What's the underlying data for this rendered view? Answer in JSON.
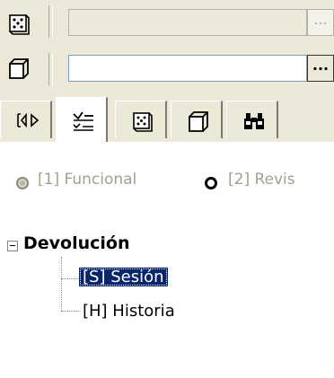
{
  "toolbar": {
    "row1": {
      "icon": "dice-icon",
      "field_value": "",
      "button_label": "..."
    },
    "row2": {
      "icon": "cube-icon",
      "field_value": "",
      "button_label": "..."
    }
  },
  "tabs": [
    {
      "name": "tab-navigate",
      "icon": "navigate-arrows-icon",
      "active": false
    },
    {
      "name": "tab-checklist",
      "icon": "checklist-icon",
      "active": true
    },
    {
      "name": "tab-dice",
      "icon": "dice-icon",
      "active": false
    },
    {
      "name": "tab-cube",
      "icon": "cube-icon",
      "active": false
    },
    {
      "name": "tab-binoculars",
      "icon": "binoculars-icon",
      "active": false
    }
  ],
  "radios": [
    {
      "label": "[1] Funcional",
      "selected": false,
      "enabled": false
    },
    {
      "label": "[2] Revis",
      "selected": false,
      "enabled": true
    }
  ],
  "tree": {
    "root_label": "Devolución",
    "root_expanded": true,
    "children": [
      {
        "label": "[S] Sesión",
        "selected": true
      },
      {
        "label": "[H] Historia",
        "selected": false
      }
    ]
  },
  "colors": {
    "selection": "#0a246a",
    "panel_bg": "#ece9d8"
  }
}
